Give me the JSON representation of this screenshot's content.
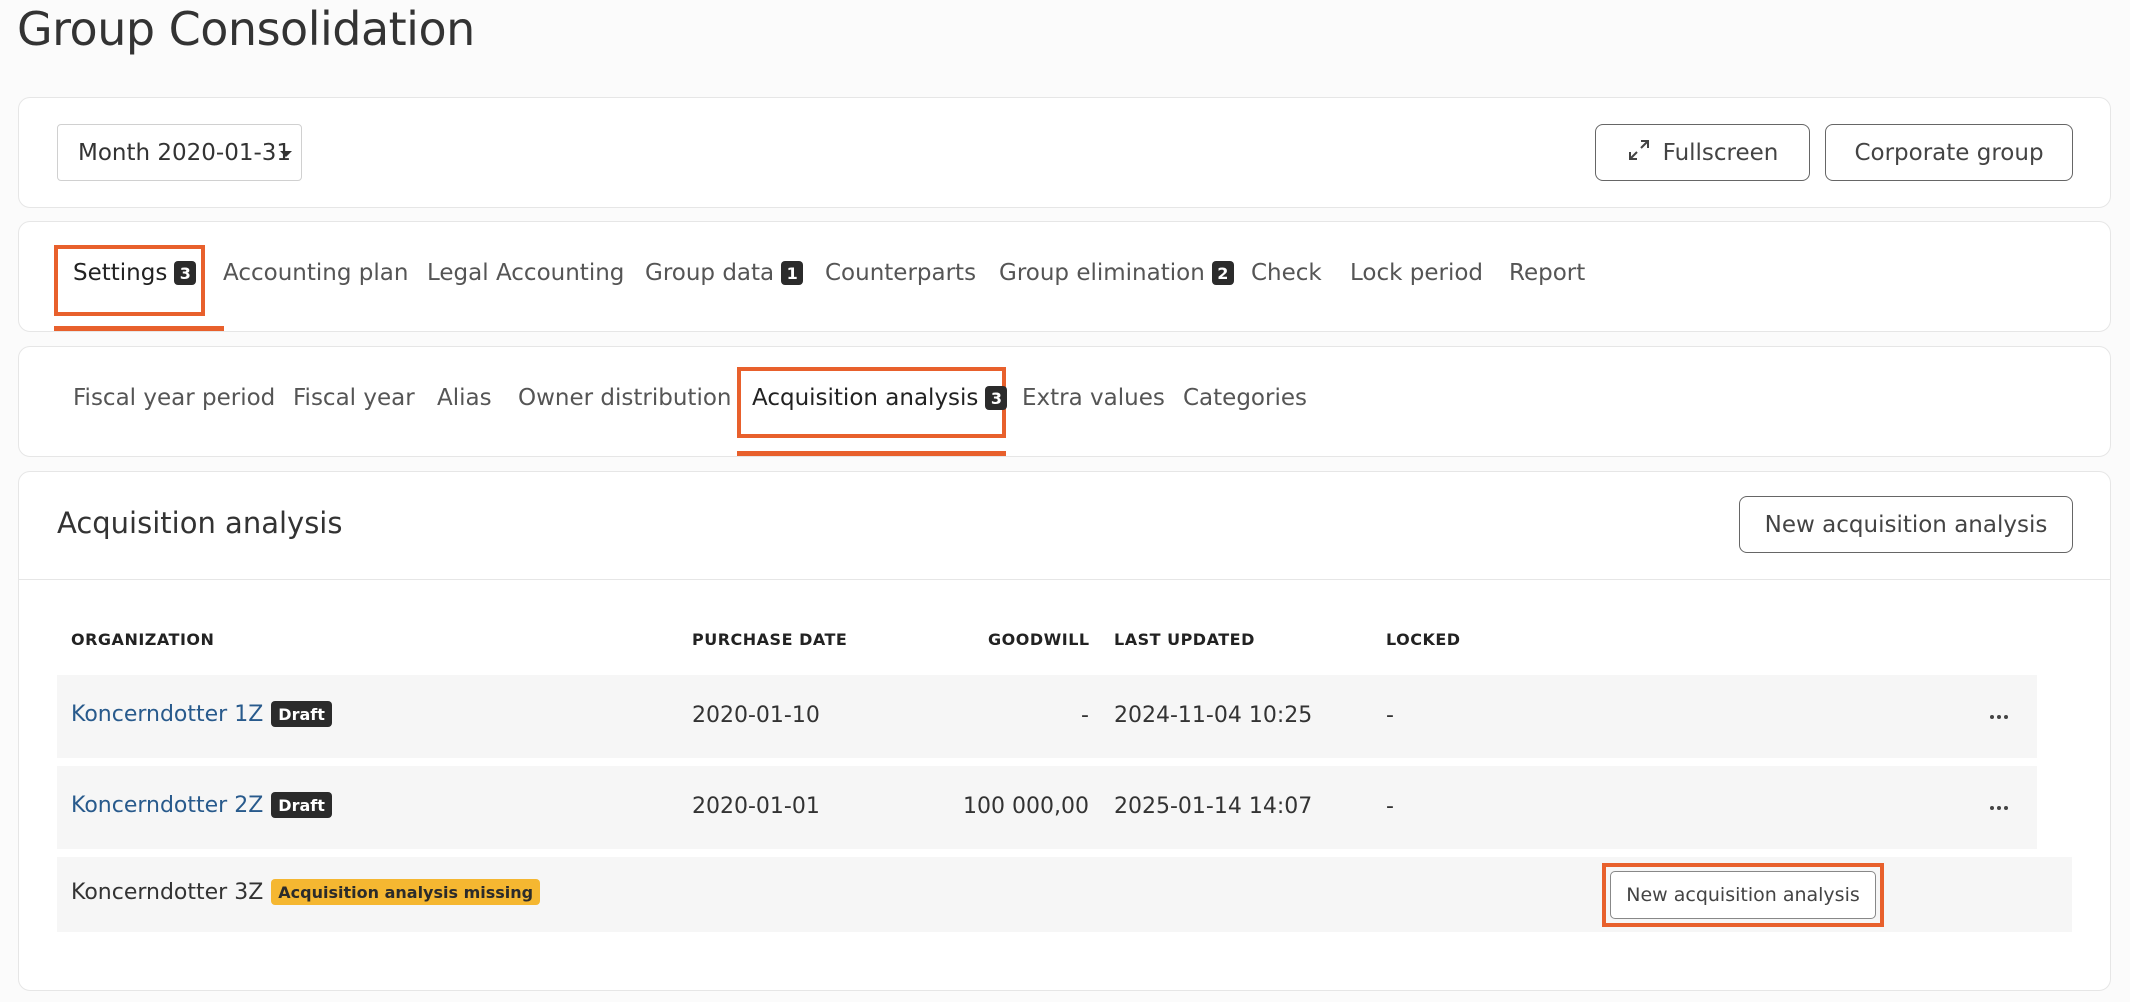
{
  "page": {
    "title": "Group Consolidation"
  },
  "toolbar": {
    "period_label": "Month 2020-01-31",
    "fullscreen_label": "Fullscreen",
    "fullscreen_icon": "expand-arrows-icon",
    "corporate_group_label": "Corporate group"
  },
  "main_tabs": [
    {
      "label": "Settings",
      "badge": "3",
      "active": true
    },
    {
      "label": "Accounting plan"
    },
    {
      "label": "Legal Accounting"
    },
    {
      "label": "Group data",
      "badge": "1"
    },
    {
      "label": "Counterparts"
    },
    {
      "label": "Group elimination",
      "badge": "2"
    },
    {
      "label": "Check"
    },
    {
      "label": "Lock period"
    },
    {
      "label": "Report"
    }
  ],
  "sub_tabs": [
    {
      "label": "Fiscal year period"
    },
    {
      "label": "Fiscal year"
    },
    {
      "label": "Alias"
    },
    {
      "label": "Owner distribution"
    },
    {
      "label": "Acquisition analysis",
      "badge": "3",
      "active": true
    },
    {
      "label": "Extra values"
    },
    {
      "label": "Categories"
    }
  ],
  "section": {
    "title": "Acquisition analysis",
    "new_button_label": "New acquisition analysis"
  },
  "table": {
    "headers": {
      "organization": "ORGANIZATION",
      "purchase_date": "PURCHASE DATE",
      "goodwill": "GOODWILL",
      "last_updated": "LAST UPDATED",
      "locked": "LOCKED"
    },
    "rows": [
      {
        "organization": "Koncerndotter 1Z",
        "tag": "Draft",
        "purchase_date": "2020-01-10",
        "goodwill": "-",
        "last_updated": "2024-11-04 10:25",
        "locked": "-"
      },
      {
        "organization": "Koncerndotter 2Z",
        "tag": "Draft",
        "purchase_date": "2020-01-01",
        "goodwill": "100 000,00",
        "last_updated": "2025-01-14 14:07",
        "locked": "-"
      }
    ],
    "missing_row": {
      "organization": "Koncerndotter 3Z",
      "tag": "Acquisition analysis missing",
      "button_label": "New acquisition analysis"
    }
  },
  "colors": {
    "highlight": "#e8602c",
    "link": "#285a8c",
    "warning_tag": "#f5b731",
    "badge_dark": "#2b2b2b"
  }
}
